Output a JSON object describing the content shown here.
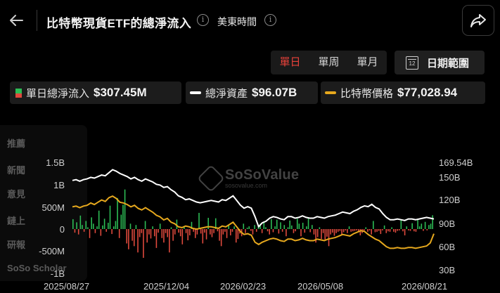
{
  "header": {
    "title": "比特幣現貨ETF的總淨流入",
    "timezone": "美東時間",
    "back_icon": "arrow-left-icon",
    "share_icon": "share-icon"
  },
  "tabs": [
    {
      "label": "單日",
      "active": true
    },
    {
      "label": "單周",
      "active": false
    },
    {
      "label": "單月",
      "active": false
    }
  ],
  "date_range": {
    "label": "日期範圍",
    "icon_text": "12"
  },
  "legend": [
    {
      "name": "單日總淨流入",
      "value": "$307.45M",
      "color": "#2dbd55"
    },
    {
      "name": "總淨資產",
      "value": "$96.07B",
      "color": "#ffffff"
    },
    {
      "name": "比特幣價格",
      "value": "$77,028.94",
      "color": "#e6a81d"
    }
  ],
  "side_panel": [
    "推薦",
    "新聞",
    "意見",
    "鏈上",
    "研報",
    "SoSo Scholar"
  ],
  "watermark": {
    "title": "SoSoValue",
    "url": "sosovalue.com"
  },
  "chart_data": {
    "type": "bar",
    "x_ticks": [
      "2025/08/27",
      "2025/12/04",
      "2026/02/23",
      "2026/05/08",
      "2026/08/21"
    ],
    "y_left_ticks": [
      "1.5B",
      "1B",
      "500M",
      "0",
      "-500M",
      "-1B"
    ],
    "y_left_range": [
      -1000,
      1500
    ],
    "y_right_ticks": [
      "169.54B",
      "150B",
      "120B",
      "90B",
      "60B",
      "30B"
    ],
    "y_right_range": [
      30,
      169.54
    ],
    "colors": {
      "inflow": "#2dbd55",
      "outflow": "#e04a3d",
      "assets": "#ffffff",
      "price": "#e6a81d"
    },
    "series": [
      {
        "name": "單日總淨流入",
        "unit": "M",
        "values": [
          220,
          -80,
          150,
          -120,
          300,
          90,
          -60,
          180,
          40,
          -200,
          260,
          120,
          -90,
          60,
          410,
          -150,
          80,
          230,
          -60,
          140,
          520,
          -110,
          60,
          180,
          690,
          -200,
          320,
          540,
          880,
          -320,
          -450,
          120,
          -260,
          -380,
          90,
          -520,
          -180,
          -90,
          -640,
          180,
          -300,
          -120,
          -210,
          60,
          -160,
          -420,
          -80,
          120,
          -200,
          -300,
          -90,
          -180,
          -520,
          40,
          -260,
          -120,
          210,
          -80,
          -160,
          -340,
          40,
          -90,
          -250,
          -140,
          160,
          -60,
          -200,
          -120,
          360,
          -100,
          -320,
          -80,
          -230,
          250,
          -120,
          -180,
          -90,
          240,
          -50,
          -260,
          -380,
          -120,
          -60,
          -200,
          80,
          -140,
          -60,
          60,
          -300,
          -220,
          -100,
          -160,
          120,
          -90,
          30,
          60,
          -40,
          -120,
          90,
          -60,
          80,
          120,
          -90,
          160,
          40,
          -50,
          -120,
          220,
          -70,
          60,
          210,
          -100,
          150,
          -60,
          90,
          -160,
          40,
          190,
          80,
          -90,
          -50,
          230,
          120,
          -160,
          140,
          -80,
          60,
          260,
          -70,
          90,
          -120,
          -300,
          -180,
          40,
          -220,
          -90,
          -260,
          -170,
          -380,
          -120,
          -80,
          -150,
          -90,
          -60,
          -40,
          -120,
          -70,
          -30,
          -90,
          60,
          -60,
          -50,
          -40,
          -30,
          -60,
          -140,
          -90,
          -50,
          40,
          -60,
          -30,
          -120,
          180,
          -70,
          -60,
          -40,
          -110,
          -30,
          80,
          -90,
          -50,
          -60,
          40,
          -60,
          -80,
          -40,
          -30,
          210,
          -50,
          -140,
          60,
          -30,
          -40,
          130,
          -50,
          -60,
          210,
          60,
          120,
          -40,
          160,
          -30,
          90,
          120,
          307
        ]
      },
      {
        "name": "總淨資產",
        "unit": "B",
        "values": [
          146,
          147,
          145,
          147,
          148,
          150,
          149,
          151,
          153,
          152,
          156,
          160,
          158,
          155,
          153,
          151,
          148,
          150,
          147,
          145,
          148,
          146,
          144,
          141,
          140,
          137,
          138,
          134,
          131,
          126,
          124,
          121,
          122,
          120,
          118,
          117,
          118,
          119,
          120,
          119,
          118,
          121,
          120,
          123,
          126,
          120,
          114,
          110,
          112,
          110,
          99,
          86,
          91,
          93,
          97,
          99,
          98,
          96,
          95,
          99,
          99,
          97,
          98,
          100,
          98,
          97,
          97,
          99,
          98,
          97,
          99,
          100,
          101,
          103,
          105,
          104,
          103,
          106,
          108,
          111,
          113,
          112,
          115,
          111,
          109,
          103,
          98,
          95,
          95,
          96,
          95,
          94,
          96,
          96,
          95,
          96,
          97,
          98,
          97,
          96
        ]
      },
      {
        "name": "比特幣價格",
        "unit": "USD",
        "values": [
          112000,
          113000,
          111000,
          113000,
          114000,
          117000,
          115000,
          118000,
          121000,
          119000,
          124000,
          126000,
          123000,
          118000,
          117000,
          115000,
          112000,
          114000,
          110000,
          108000,
          111000,
          108000,
          105000,
          101000,
          99000,
          95000,
          97000,
          92000,
          90000,
          86000,
          85000,
          87000,
          86000,
          84000,
          83000,
          84000,
          85000,
          86000,
          86000,
          85000,
          84000,
          87000,
          86000,
          89000,
          92000,
          86000,
          80000,
          76000,
          77000,
          75000,
          66000,
          63000,
          66000,
          68000,
          70000,
          71000,
          70000,
          68000,
          67000,
          70000,
          70000,
          68000,
          69000,
          71000,
          69000,
          68000,
          68000,
          70000,
          69000,
          68000,
          70000,
          71000,
          72000,
          74000,
          76000,
          75000,
          74000,
          77000,
          79000,
          81000,
          80000,
          76000,
          73000,
          70000,
          68000,
          64000,
          60000,
          58000,
          58000,
          59000,
          58000,
          58000,
          59000,
          59000,
          58000,
          59000,
          60000,
          61000,
          65000,
          77029
        ]
      }
    ]
  }
}
